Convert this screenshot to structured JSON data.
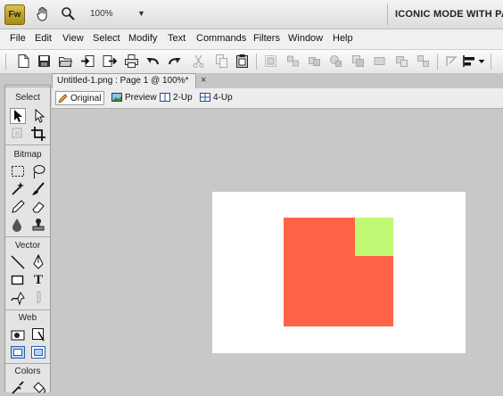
{
  "titlebar": {
    "logo": "Fw",
    "zoom_value": "100%",
    "zoom_dropdown": "▼",
    "mode_label": "ICONIC MODE WITH PAN"
  },
  "menu": [
    "File",
    "Edit",
    "View",
    "Select",
    "Modify",
    "Text",
    "Commands",
    "Filters",
    "Window",
    "Help"
  ],
  "document": {
    "tab_title": "Untitled-1.png : Page 1 @ 100%*",
    "close": "×"
  },
  "views": [
    "Original",
    "Preview",
    "2-Up",
    "4-Up"
  ],
  "tools": {
    "select_label": "Select",
    "bitmap_label": "Bitmap",
    "vector_label": "Vector",
    "web_label": "Web",
    "colors_label": "Colors",
    "text_tool_glyph": "T"
  },
  "canvas_colors": {
    "background": "#ffffff",
    "red_rect": "#ff6347",
    "green_rect": "#c0fa75"
  }
}
